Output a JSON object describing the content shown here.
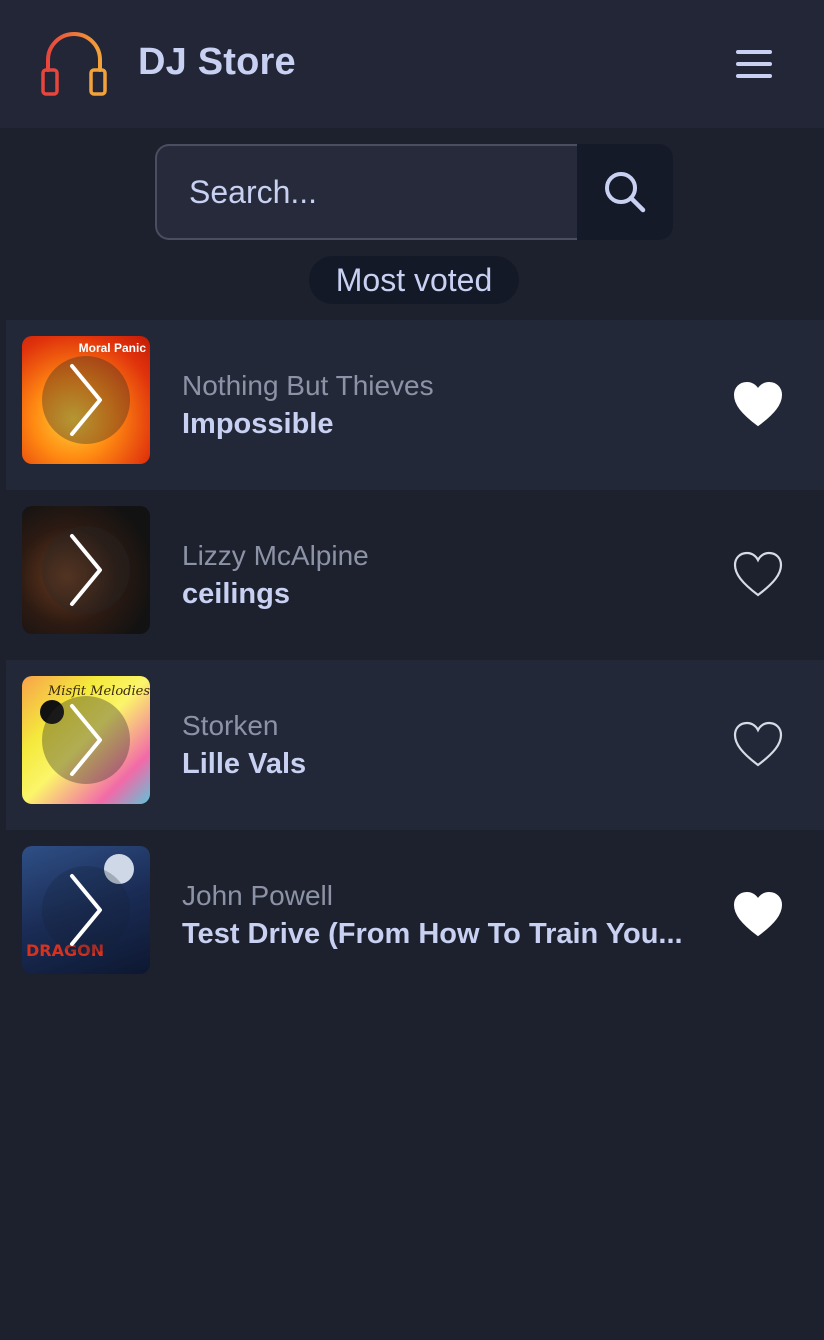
{
  "app": {
    "title": "DJ Store",
    "logo_icon": "headphones-icon",
    "menu_icon": "hamburger-menu-icon"
  },
  "search": {
    "placeholder": "Search...",
    "value": "",
    "button_icon": "search-icon"
  },
  "filter": {
    "label": "Most voted"
  },
  "colors": {
    "background": "#1d202d",
    "header": "#222636",
    "text_primary": "#c8d1f2",
    "text_secondary": "#8d93a6",
    "logo_gradient": [
      "#e8463c",
      "#f3a23a"
    ]
  },
  "songs": [
    {
      "artist": "Nothing But Thieves",
      "title": "Impossible",
      "liked": true,
      "play_icon": "chevron-right-icon",
      "like_icon": "heart-icon",
      "art_text": "Moral Panic"
    },
    {
      "artist": "Lizzy McAlpine",
      "title": "ceilings",
      "liked": false,
      "play_icon": "chevron-right-icon",
      "like_icon": "heart-icon",
      "art_text": ""
    },
    {
      "artist": "Storken",
      "title": "Lille Vals",
      "liked": false,
      "play_icon": "chevron-right-icon",
      "like_icon": "heart-icon",
      "art_text": "Misfit Melodies"
    },
    {
      "artist": "John Powell",
      "title": "Test Drive (From How To Train You...",
      "liked": true,
      "play_icon": "chevron-right-icon",
      "like_icon": "heart-icon",
      "art_text": "DRAGON"
    }
  ]
}
